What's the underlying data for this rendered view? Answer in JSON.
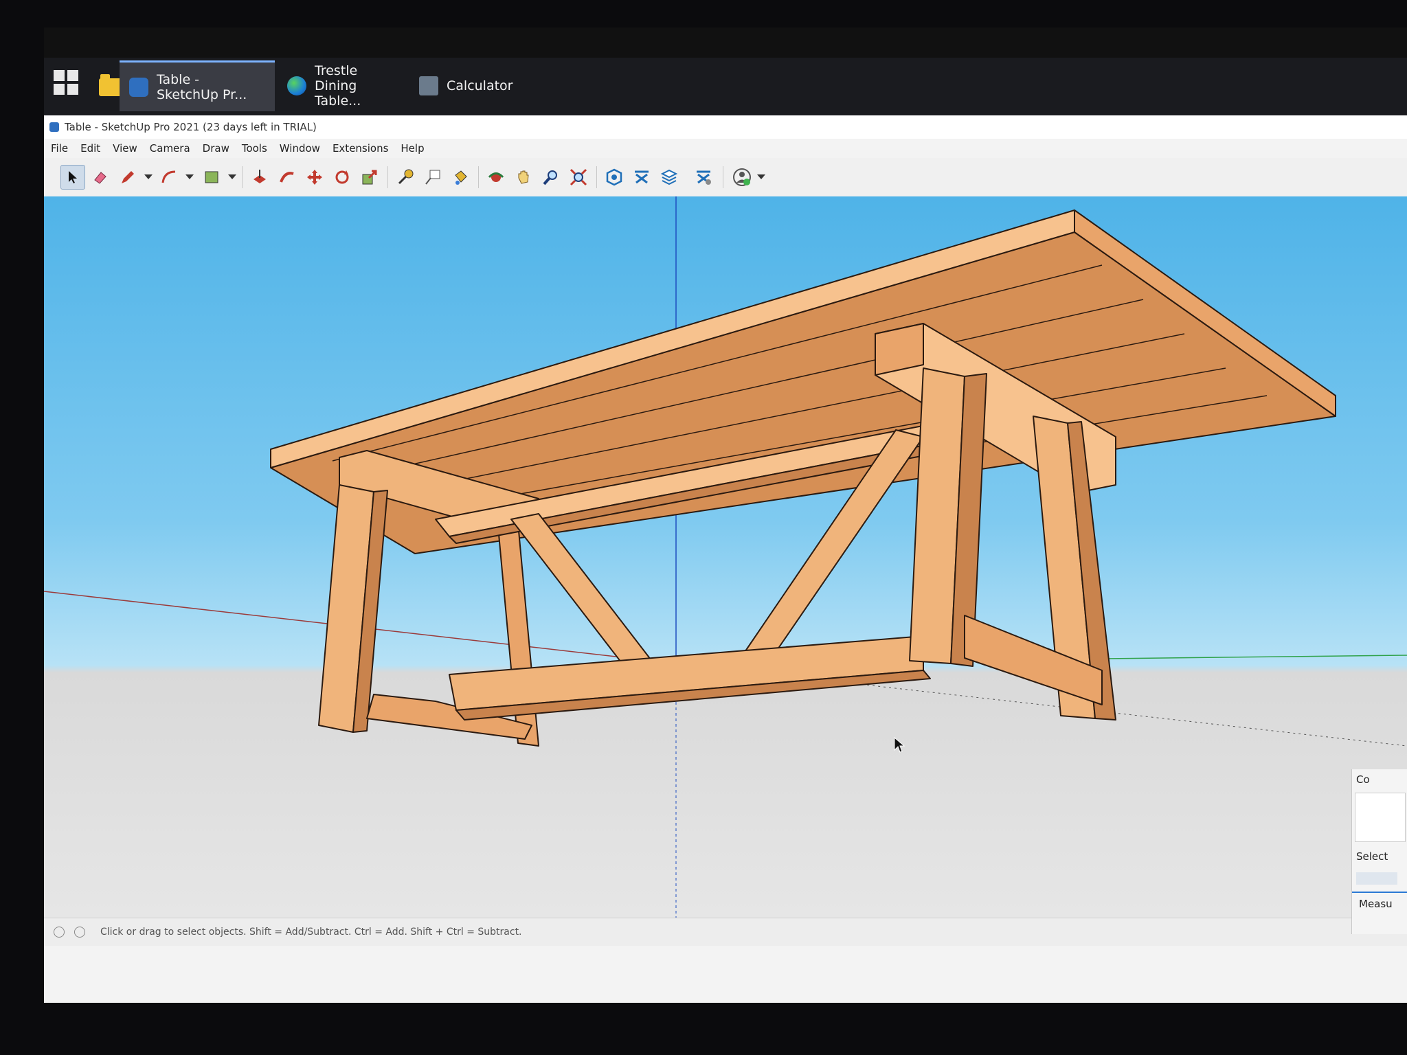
{
  "taskbar": {
    "tasks": [
      {
        "label": "Table - SketchUp Pr...",
        "icon": "sketchup-icon"
      },
      {
        "label": "Trestle Dining Table...",
        "icon": "edge-icon"
      },
      {
        "label": "Calculator",
        "icon": "calculator-icon"
      }
    ]
  },
  "window": {
    "title": "Table - SketchUp Pro 2021 (23 days left in TRIAL)"
  },
  "menu": [
    "File",
    "Edit",
    "View",
    "Camera",
    "Draw",
    "Tools",
    "Window",
    "Extensions",
    "Help"
  ],
  "toolbar": {
    "tools": [
      "select-icon",
      "eraser-icon",
      "pencil-icon",
      "arc-icon",
      "rectangle-icon",
      "push-pull-icon",
      "follow-me-icon",
      "move-icon",
      "rotate-icon",
      "scale-icon",
      "tape-measure-icon",
      "text-icon",
      "paint-bucket-icon",
      "orbit-icon",
      "pan-icon",
      "zoom-icon",
      "zoom-extents-icon",
      "warehouse-icon",
      "extension-warehouse-icon",
      "layout-icon",
      "extension-manager-icon",
      "account-icon"
    ]
  },
  "status": {
    "hint": "Click or drag to select objects. Shift = Add/Subtract. Ctrl = Add. Shift + Ctrl = Subtract."
  },
  "tray": {
    "header": "Co",
    "select_label": "Select",
    "measure_label": "Measu"
  },
  "colors": {
    "wood_top": "#f7c28e",
    "wood_side": "#e9a46a",
    "wood_dark": "#c9834d",
    "sky": "#4fb3e8",
    "ground": "#dcdcdc"
  }
}
